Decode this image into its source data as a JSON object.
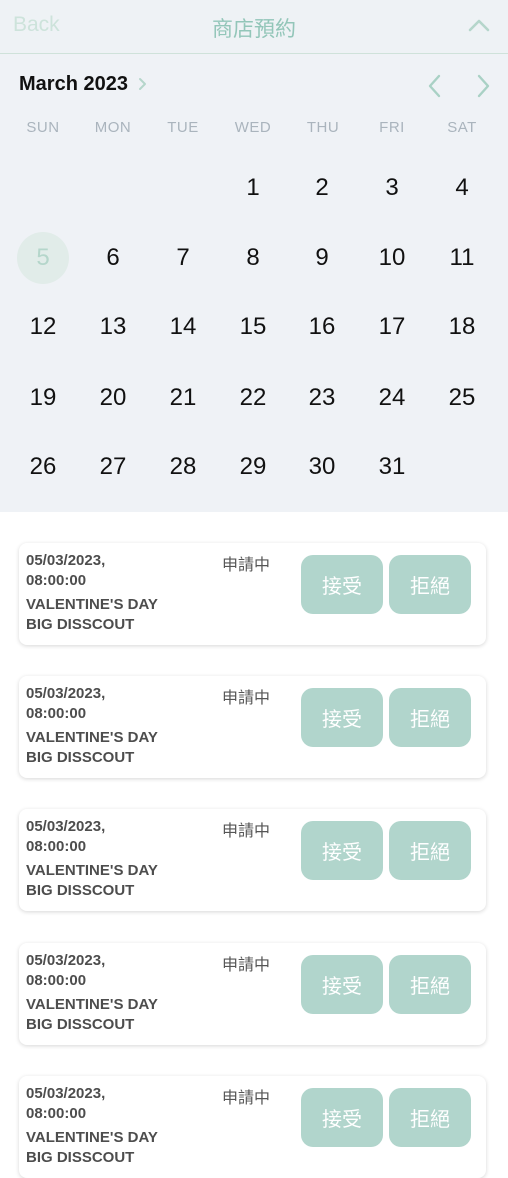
{
  "header": {
    "back_label": "Back",
    "title": "商店預約"
  },
  "calendar": {
    "month_label": "March 2023",
    "weekdays": [
      "SUN",
      "MON",
      "TUE",
      "WED",
      "THU",
      "FRI",
      "SAT"
    ],
    "weeks": [
      [
        "",
        "",
        "",
        "1",
        "2",
        "3",
        "4"
      ],
      [
        "5",
        "6",
        "7",
        "8",
        "9",
        "10",
        "11"
      ],
      [
        "12",
        "13",
        "14",
        "15",
        "16",
        "17",
        "18"
      ],
      [
        "19",
        "20",
        "21",
        "22",
        "23",
        "24",
        "25"
      ],
      [
        "26",
        "27",
        "28",
        "29",
        "30",
        "31",
        ""
      ]
    ],
    "selected_day": "5"
  },
  "bookings": [
    {
      "datetime": "05/03/2023,\n08:00:00",
      "event": "VALENTINE'S DAY\nBIG DISSCOUT",
      "status": "申請中",
      "accept_label": "接受",
      "reject_label": "拒絕"
    },
    {
      "datetime": "05/03/2023,\n08:00:00",
      "event": "VALENTINE'S DAY\nBIG DISSCOUT",
      "status": "申請中",
      "accept_label": "接受",
      "reject_label": "拒絕"
    },
    {
      "datetime": "05/03/2023,\n08:00:00",
      "event": "VALENTINE'S DAY\nBIG DISSCOUT",
      "status": "申請中",
      "accept_label": "接受",
      "reject_label": "拒絕"
    },
    {
      "datetime": "05/03/2023,\n08:00:00",
      "event": "VALENTINE'S DAY\nBIG DISSCOUT",
      "status": "申請中",
      "accept_label": "接受",
      "reject_label": "拒絕"
    },
    {
      "datetime": "05/03/2023,\n08:00:00",
      "event": "VALENTINE'S DAY\nBIG DISSCOUT",
      "status": "申請中",
      "accept_label": "接受",
      "reject_label": "拒絕"
    }
  ],
  "colors": {
    "accent": "#b1d5cc",
    "header_bg": "#eef2f5",
    "title": "#93c6b9",
    "selected_day_bg": "#e1ece9"
  }
}
